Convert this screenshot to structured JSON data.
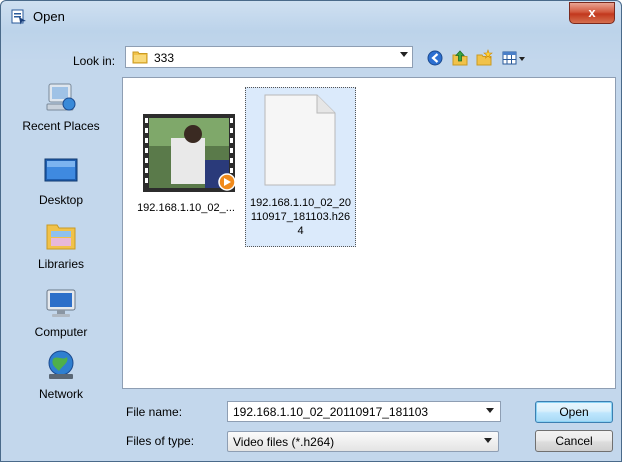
{
  "window": {
    "title": "Open",
    "close_glyph": "x"
  },
  "lookin": {
    "label": "Look in:",
    "value": "333"
  },
  "toolbar": {
    "icons": [
      "back-icon",
      "up-folder-icon",
      "new-folder-icon",
      "view-menu-icon"
    ]
  },
  "places": [
    {
      "label": "Recent Places",
      "icon": "recent-places-icon"
    },
    {
      "label": "Desktop",
      "icon": "desktop-icon"
    },
    {
      "label": "Libraries",
      "icon": "libraries-icon"
    },
    {
      "label": "Computer",
      "icon": "computer-icon"
    },
    {
      "label": "Network",
      "icon": "network-icon"
    }
  ],
  "files": [
    {
      "label": "192.168.1.10_02_...",
      "icon": "video-thumbnail-icon"
    },
    {
      "label_lines": [
        "192.168.1.10_02_20",
        "110917_181103.h26",
        "4"
      ],
      "icon": "blank-file-icon",
      "selected": true
    }
  ],
  "filename": {
    "label": "File name:",
    "value": "192.168.1.10_02_20110917_181103"
  },
  "filetype": {
    "label": "Files of type:",
    "value": "Video files (*.h264)"
  },
  "buttons": {
    "open": "Open",
    "cancel": "Cancel"
  },
  "colors": {
    "titlebar": "#bcd3ea",
    "close": "#c2381d",
    "selection": "#dbeafb",
    "default_button": "#3c7fb1"
  }
}
